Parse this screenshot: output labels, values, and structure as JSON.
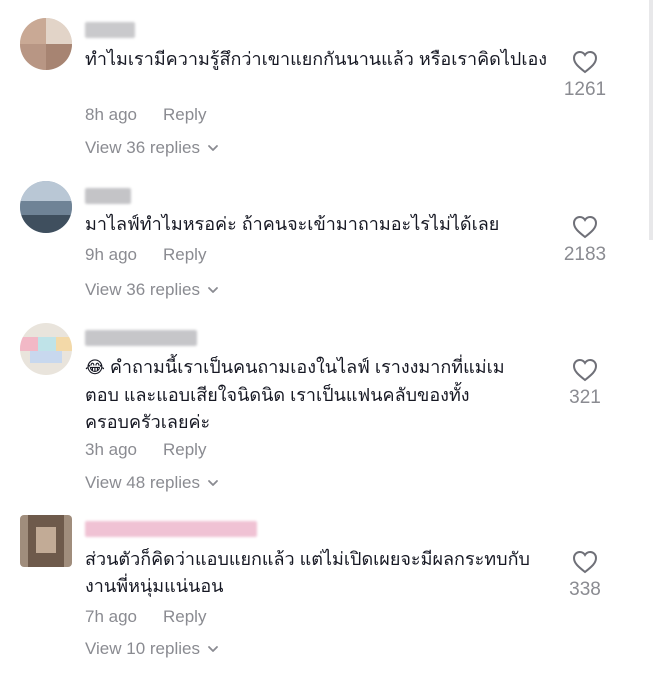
{
  "comments": [
    {
      "text": "ทำไมเรามีความรู้สึกว่าเขาแยกกันนานแล้ว หรือเราคิดไปเอง",
      "time": "8h ago",
      "reply_label": "Reply",
      "view_replies": "View 36 replies",
      "likes": "1261"
    },
    {
      "text": "มาไลฟ์ทำไมหรอค่ะ ถ้าคนจะเข้ามาถามอะไรไม่ได้เลย",
      "time": "9h ago",
      "reply_label": "Reply",
      "view_replies": "View 36 replies",
      "likes": "2183"
    },
    {
      "emoji": "😂",
      "text": "คำถามนี้เราเป็นคนถามเองในไลฟ์ เรางงมากที่แม่เมตอบ และแอบเสียใจนิดนิด เราเป็นแฟนคลับของทั้งครอบครัวเลยค่ะ",
      "time": "3h ago",
      "reply_label": "Reply",
      "view_replies": "View 48 replies",
      "likes": "321"
    },
    {
      "text": "ส่วนตัวก็คิดว่าแอบแยกแล้ว แต่ไม่เปิดเผยจะมีผลกระทบกับงานพี่หนุ่มแน่นอน",
      "time": "7h ago",
      "reply_label": "Reply",
      "view_replies": "View 10 replies",
      "likes": "338"
    }
  ],
  "icons": {
    "like": "heart-outline-icon",
    "expand": "chevron-down-icon"
  },
  "colors": {
    "text": "#161823",
    "secondary": "#8a8b91"
  }
}
